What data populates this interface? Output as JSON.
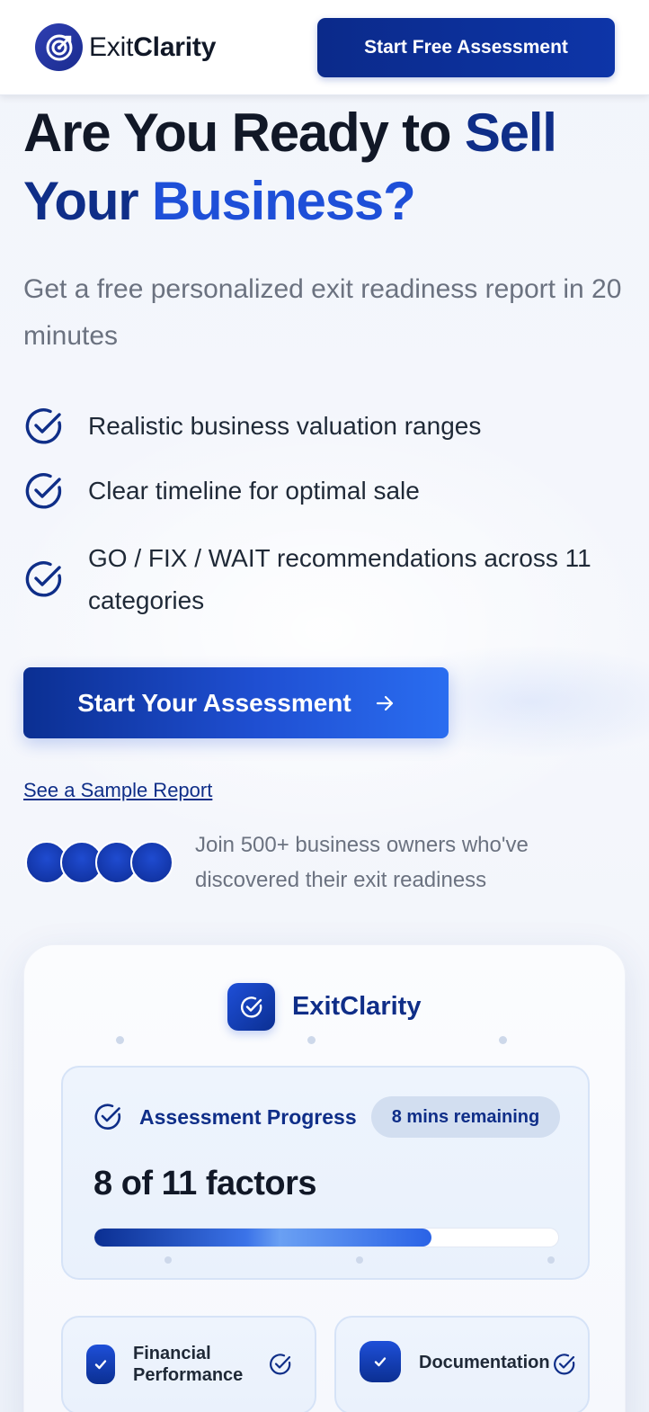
{
  "header": {
    "brand_part1": "Exit",
    "brand_part2": "Clarity",
    "cta_label": "Start Free Assessment"
  },
  "hero": {
    "title_part1": "Are You Ready to ",
    "title_part2": "Sell",
    "title_part3": "Your ",
    "title_part4": "Business?",
    "subtitle": "Get a free personalized exit readiness report in 20 minutes",
    "features": [
      "Realistic business valuation ranges",
      "Clear timeline for optimal sale",
      "GO / FIX / WAIT recommendations across 11 categories"
    ],
    "cta_label": "Start Your Assessment",
    "sample_link": "See a Sample Report",
    "social_proof": "Join 500+ business owners who've discovered their exit readiness"
  },
  "card": {
    "brand": "ExitClarity",
    "progress_label": "Assessment Progress",
    "time_remaining": "8 mins remaining",
    "factors_text": "8 of 11 factors",
    "progress_fraction": 0.727,
    "tiles": [
      {
        "label_line1": "Financial",
        "label_line2": "Performance"
      },
      {
        "label_line1": "Documentation",
        "label_line2": ""
      }
    ]
  },
  "colors": {
    "primary": "#0f2e88",
    "accent": "#1e4fd8",
    "text": "#111827",
    "muted": "#6b7280"
  },
  "icons": [
    "target-logo-icon",
    "check-circle-icon",
    "arrow-right-icon",
    "check-icon"
  ]
}
